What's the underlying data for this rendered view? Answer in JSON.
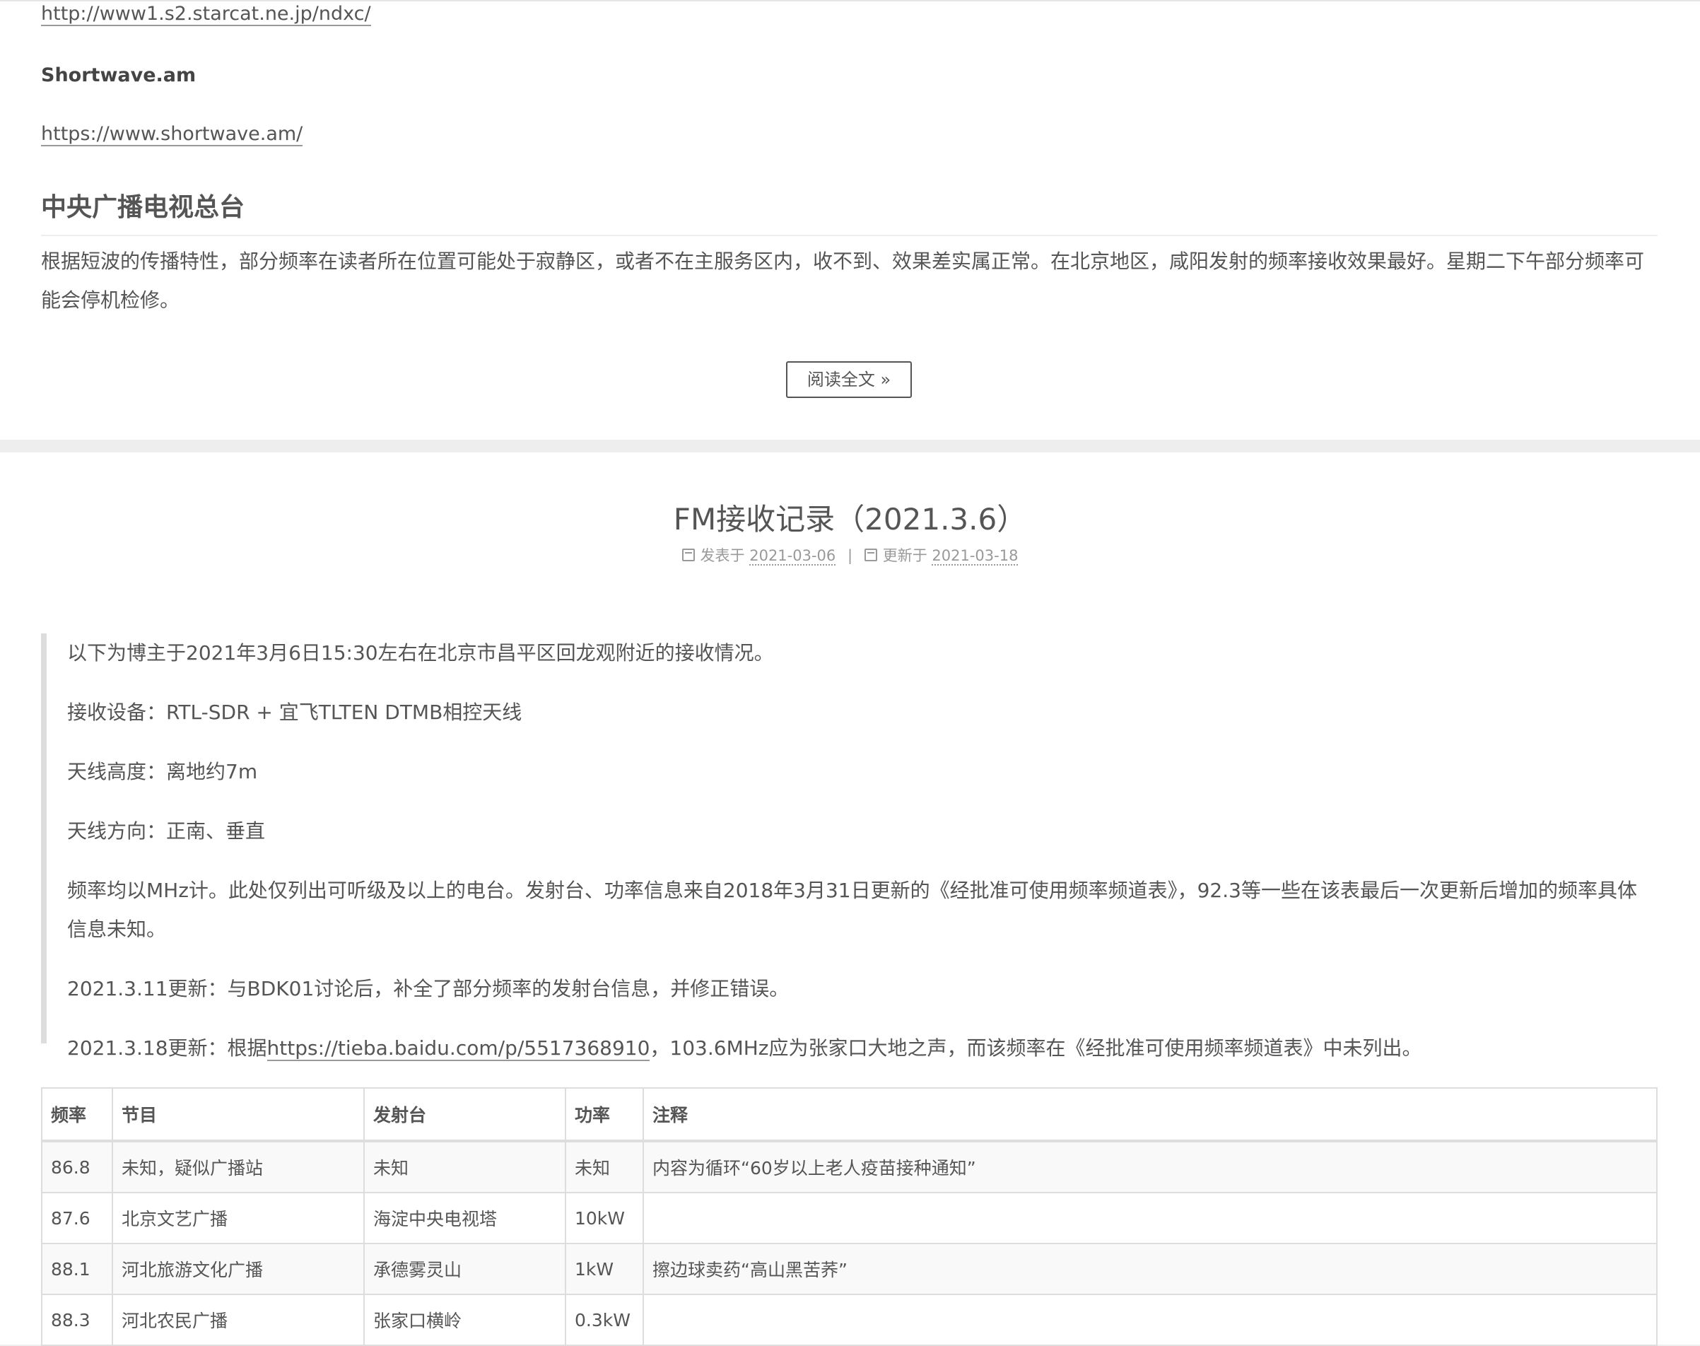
{
  "top_post": {
    "link1": "http://www1.s2.starcat.ne.jp/ndxc/",
    "site2_name": "Shortwave.am",
    "link2": "https://www.shortwave.am/",
    "section_heading": "中央广播电视总台",
    "section_text": "根据短波的传播特性，部分频率在读者所在位置可能处于寂静区，或者不在主服务区内，收不到、效果差实属正常。在北京地区，咸阳发射的频率接收效果最好。星期二下午部分频率可能会停机检修。",
    "read_more": "阅读全文 »"
  },
  "post": {
    "title": "FM接收记录（2021.3.6）",
    "meta": {
      "posted_label": "发表于",
      "posted_date": "2021-03-06",
      "separator": "|",
      "updated_label": "更新于",
      "updated_date": "2021-03-18"
    },
    "quote": {
      "p1": "以下为博主于2021年3月6日15:30左右在北京市昌平区回龙观附近的接收情况。",
      "p2": "接收设备：RTL-SDR + 宜飞TLTEN DTMB相控天线",
      "p3": "天线高度：离地约7m",
      "p4": "天线方向：正南、垂直",
      "p5": "频率均以MHz计。此处仅列出可听级及以上的电台。发射台、功率信息来自2018年3月31日更新的《经批准可使用频率频道表》，92.3等一些在该表最后一次更新后增加的频率具体信息未知。",
      "p6": "2021.3.11更新：与BDK01讨论后，补全了部分频率的发射台信息，并修正错误。",
      "p7_prefix": "2021.3.18更新：根据",
      "p7_link": "https://tieba.baidu.com/p/5517368910",
      "p7_suffix": "，103.6MHz应为张家口大地之声，而该频率在《经批准可使用频率频道表》中未列出。"
    },
    "table": {
      "headers": {
        "freq": "频率",
        "program": "节目",
        "transmitter": "发射台",
        "power": "功率",
        "note": "注释"
      },
      "rows": [
        {
          "freq": "86.8",
          "program": "未知，疑似广播站",
          "transmitter": "未知",
          "power": "未知",
          "note": "内容为循环“60岁以上老人疫苗接种通知”"
        },
        {
          "freq": "87.6",
          "program": "北京文艺广播",
          "transmitter": "海淀中央电视塔",
          "power": "10kW",
          "note": ""
        },
        {
          "freq": "88.1",
          "program": "河北旅游文化广播",
          "transmitter": "承德雾灵山",
          "power": "1kW",
          "note": "擦边球卖药“高山黑苦荞”"
        },
        {
          "freq": "88.3",
          "program": "河北农民广播",
          "transmitter": "张家口横岭",
          "power": "0.3kW",
          "note": ""
        }
      ]
    }
  }
}
